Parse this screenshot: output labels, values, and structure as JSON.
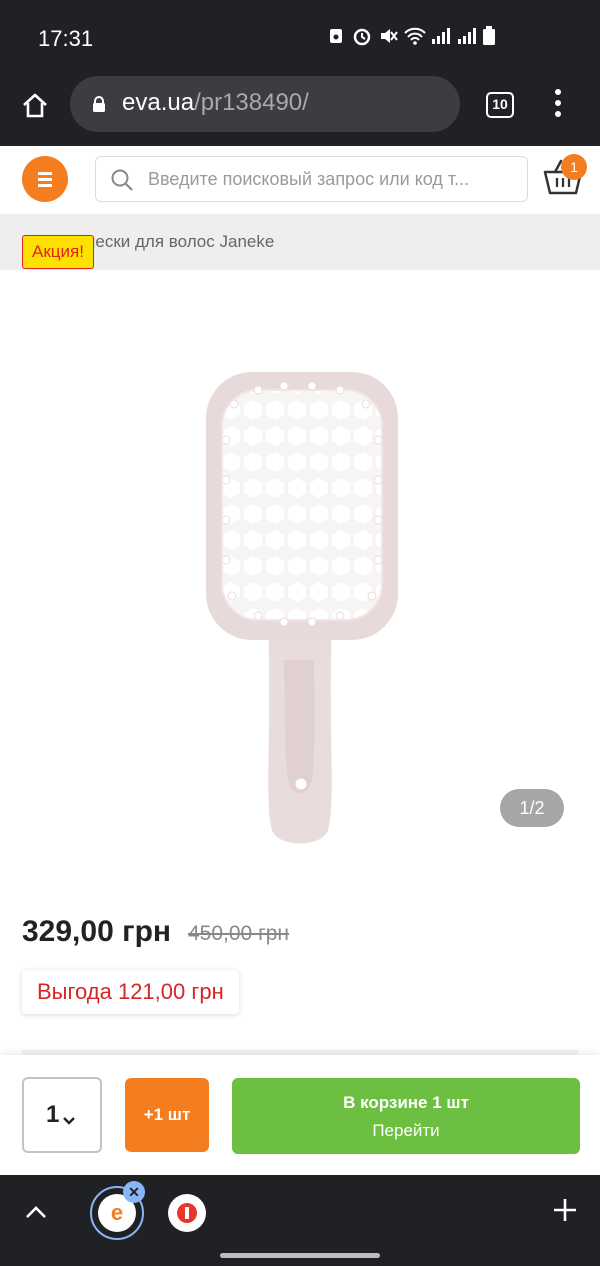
{
  "status_bar": {
    "time": "17:31"
  },
  "browser": {
    "url_host": "eva.ua",
    "url_path": "/pr138490/",
    "tab_count": "10"
  },
  "header": {
    "search_placeholder": "Введите поисковый запрос или код т...",
    "cart_count": "1",
    "accent_color": "#f47d20"
  },
  "breadcrumb": {
    "text": "Расчески для волос Janeke"
  },
  "promo": {
    "label": "Акция!"
  },
  "gallery": {
    "counter": "1/2"
  },
  "pricing": {
    "price": "329,00 грн",
    "old_price": "450,00 грн",
    "savings": "Выгода 121,00 грн"
  },
  "buy_bar": {
    "quantity": "1",
    "add_one_label": "+1 шт",
    "in_cart_title": "В корзине 1 шт",
    "in_cart_action": "Перейти",
    "green_color": "#6cbf40"
  },
  "bottom_toolbar": {
    "active_tab_icon": "e"
  }
}
